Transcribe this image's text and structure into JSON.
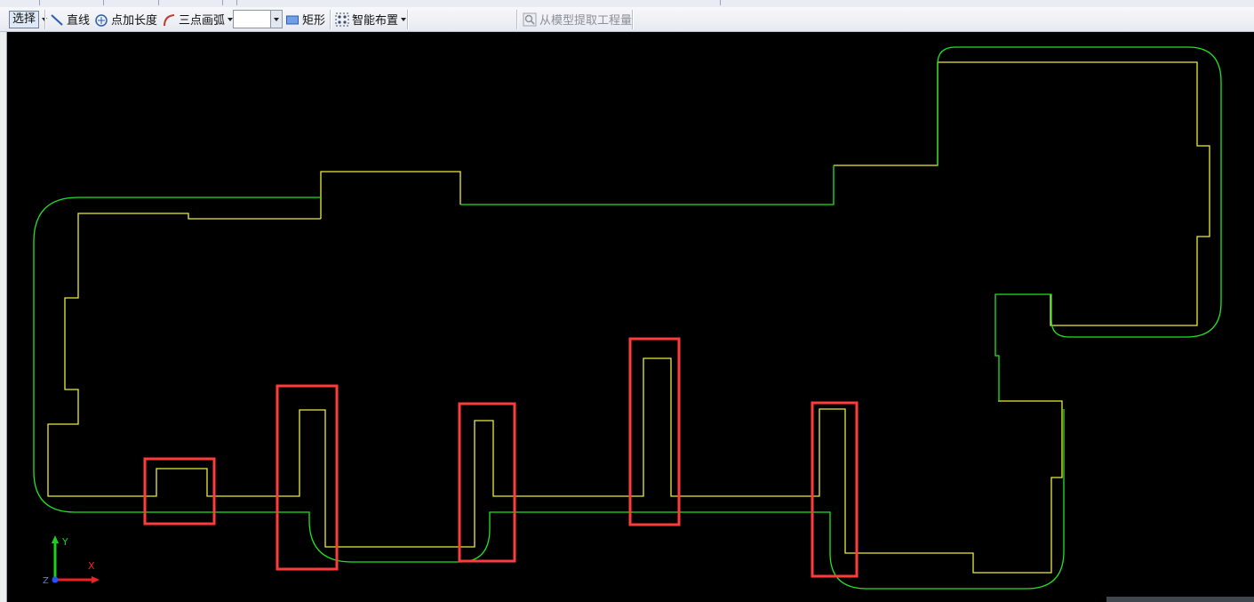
{
  "toolbar": {
    "select_label": "选择",
    "line_label": "直线",
    "point_length_label": "点加长度",
    "three_point_arc_label": "三点画弧",
    "rect_label": "矩形",
    "smart_layout_label": "智能布置",
    "extract_label": "从模型提取工程量"
  },
  "colors": {
    "canvas_bg": "#000000",
    "outline_green": "#22e322",
    "outline_yellow": "#ecec3a",
    "highlight_red": "#ff3b3b",
    "axis_y": "#1fcf1f",
    "axis_x": "#ee2222",
    "axis_z_origin": "#2255ff"
  },
  "axes": {
    "x": "X",
    "y": "Y",
    "z": "Z"
  },
  "icons": [
    "dropdown-arrow-icon",
    "line-icon",
    "point-length-icon",
    "arc-icon",
    "rectangle-icon",
    "smart-layout-icon",
    "extract-icon"
  ]
}
